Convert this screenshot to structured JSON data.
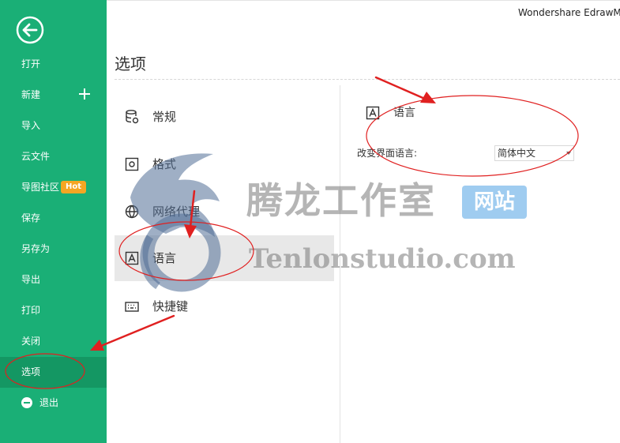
{
  "app": {
    "title": "Wondershare EdrawMind"
  },
  "sidebar": {
    "items": [
      {
        "label": "打开"
      },
      {
        "label": "新建"
      },
      {
        "label": "导入"
      },
      {
        "label": "云文件"
      },
      {
        "label": "导图社区"
      },
      {
        "label": "保存"
      },
      {
        "label": "另存为"
      },
      {
        "label": "导出"
      },
      {
        "label": "打印"
      },
      {
        "label": "关闭"
      },
      {
        "label": "选项"
      }
    ],
    "hot_badge": "Hot",
    "exit_label": "退出",
    "active_item": "选项"
  },
  "main": {
    "title": "选项",
    "categories": [
      {
        "label": "常规",
        "icon": "database-icon"
      },
      {
        "label": "格式",
        "icon": "format-icon"
      },
      {
        "label": "网络代理",
        "icon": "network-icon"
      },
      {
        "label": "语言",
        "icon": "language-icon"
      },
      {
        "label": "快捷键",
        "icon": "keyboard-icon"
      }
    ],
    "selected_category": "语言",
    "section": {
      "title": "语言",
      "field_label": "改变界面语言:",
      "select_value": "简体中文"
    }
  },
  "watermark": {
    "cn": "腾龙工作室",
    "badge": "网站",
    "en": "Tenlonstudio.com"
  },
  "colors": {
    "sidebar": "#1aaf76",
    "sidebar_active": "#149763",
    "hot": "#f5a623",
    "annotation": "#e02020"
  }
}
